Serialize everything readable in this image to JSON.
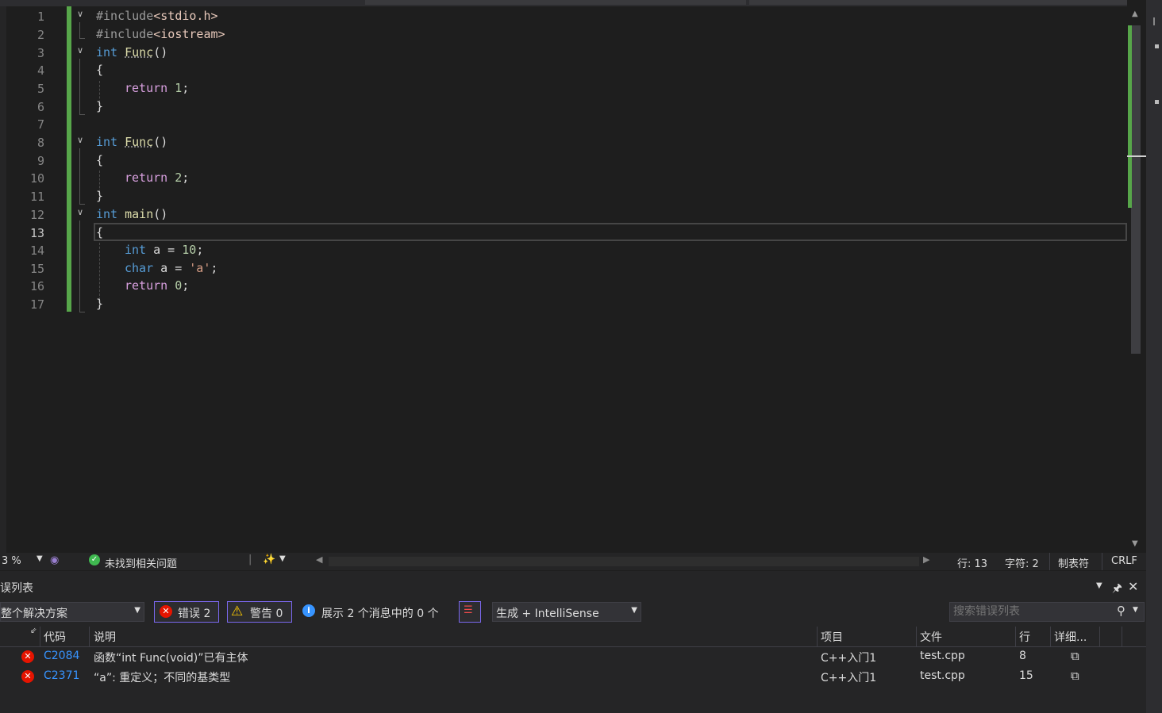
{
  "editor": {
    "lines": [
      {
        "n": "1",
        "code": "#include<stdio.h>"
      },
      {
        "n": "2",
        "code": "#include<iostream>"
      },
      {
        "n": "3",
        "code": "int Func()"
      },
      {
        "n": "4",
        "code": "{"
      },
      {
        "n": "5",
        "code": "return 1;"
      },
      {
        "n": "6",
        "code": "}"
      },
      {
        "n": "7",
        "code": ""
      },
      {
        "n": "8",
        "code": "int Func()"
      },
      {
        "n": "9",
        "code": "{"
      },
      {
        "n": "10",
        "code": "return 2;"
      },
      {
        "n": "11",
        "code": "}"
      },
      {
        "n": "12",
        "code": "int main()"
      },
      {
        "n": "13",
        "code": "{"
      },
      {
        "n": "14",
        "code": "int a = 10;"
      },
      {
        "n": "15",
        "code": "char a = 'a';"
      },
      {
        "n": "16",
        "code": "return 0;"
      },
      {
        "n": "17",
        "code": "}"
      }
    ],
    "current_line": "13"
  },
  "status": {
    "zoom": "3 %",
    "issues": "未找到相关问题",
    "line": "行: 13",
    "char": "字符: 2",
    "tabs": "制表符",
    "eol": "CRLF"
  },
  "error_list": {
    "title": "误列表",
    "scope": "整个解决方案",
    "errors_btn": "错误 2",
    "warnings_btn": "警告 0",
    "messages": "展示 2 个消息中的 0 个",
    "build_filter": "生成 + IntelliSense",
    "search_placeholder": "搜索错误列表",
    "columns": {
      "code": "代码",
      "desc": "说明",
      "project": "项目",
      "file": "文件",
      "line": "行",
      "detail": "详细..."
    },
    "rows": [
      {
        "code": "C2084",
        "desc": "函数“int Func(void)”已有主体",
        "project": "C++入门1",
        "file": "test.cpp",
        "line": "8"
      },
      {
        "code": "C2371",
        "desc": "“a”: 重定义；不同的基类型",
        "project": "C++入门1",
        "file": "test.cpp",
        "line": "15"
      }
    ]
  },
  "colors": {
    "accent": "#57a64a",
    "error": "#e51400",
    "warning": "#ffcc00",
    "info": "#3794ff"
  }
}
